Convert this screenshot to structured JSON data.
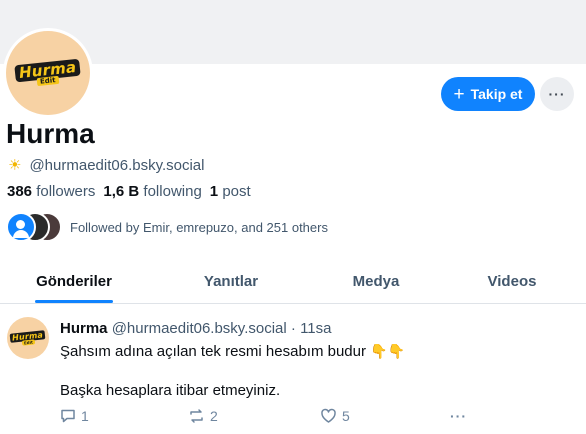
{
  "profile": {
    "logo_text": "Hurma",
    "logo_sub": "Edit",
    "display_name": "Hurma",
    "handle": "@hurmaedit06.bsky.social",
    "handle_emoji": "☀",
    "followers_count": "386",
    "followers_label": "followers",
    "following_count": "1,6 B",
    "following_label": "following",
    "posts_count": "1",
    "posts_label": "post",
    "followed_by": "Followed by Emir, emrepuzo, and 251 others"
  },
  "actions": {
    "follow_label": "Takip et",
    "follow_plus": "+",
    "more_label": "···"
  },
  "tabs": [
    {
      "label": "Gönderiler",
      "active": true
    },
    {
      "label": "Yanıtlar",
      "active": false
    },
    {
      "label": "Medya",
      "active": false
    },
    {
      "label": "Videos",
      "active": false
    }
  ],
  "post": {
    "author": "Hurma",
    "handle": "@hurmaedit06.bsky.social",
    "separator": "·",
    "time": "11sa",
    "line1": "Şahsım adına açılan tek resmi hesabım budur",
    "line1_emoji": "👇👇",
    "line2": "Başka hesaplara itibar etmeyiniz.",
    "reply_count": "1",
    "repost_count": "2",
    "like_count": "5",
    "more_label": "···"
  },
  "colors": {
    "accent": "#1083fe",
    "banner": "#f0f1f3",
    "avatar_bg": "#f7d2a4",
    "muted_text": "#42576c"
  }
}
